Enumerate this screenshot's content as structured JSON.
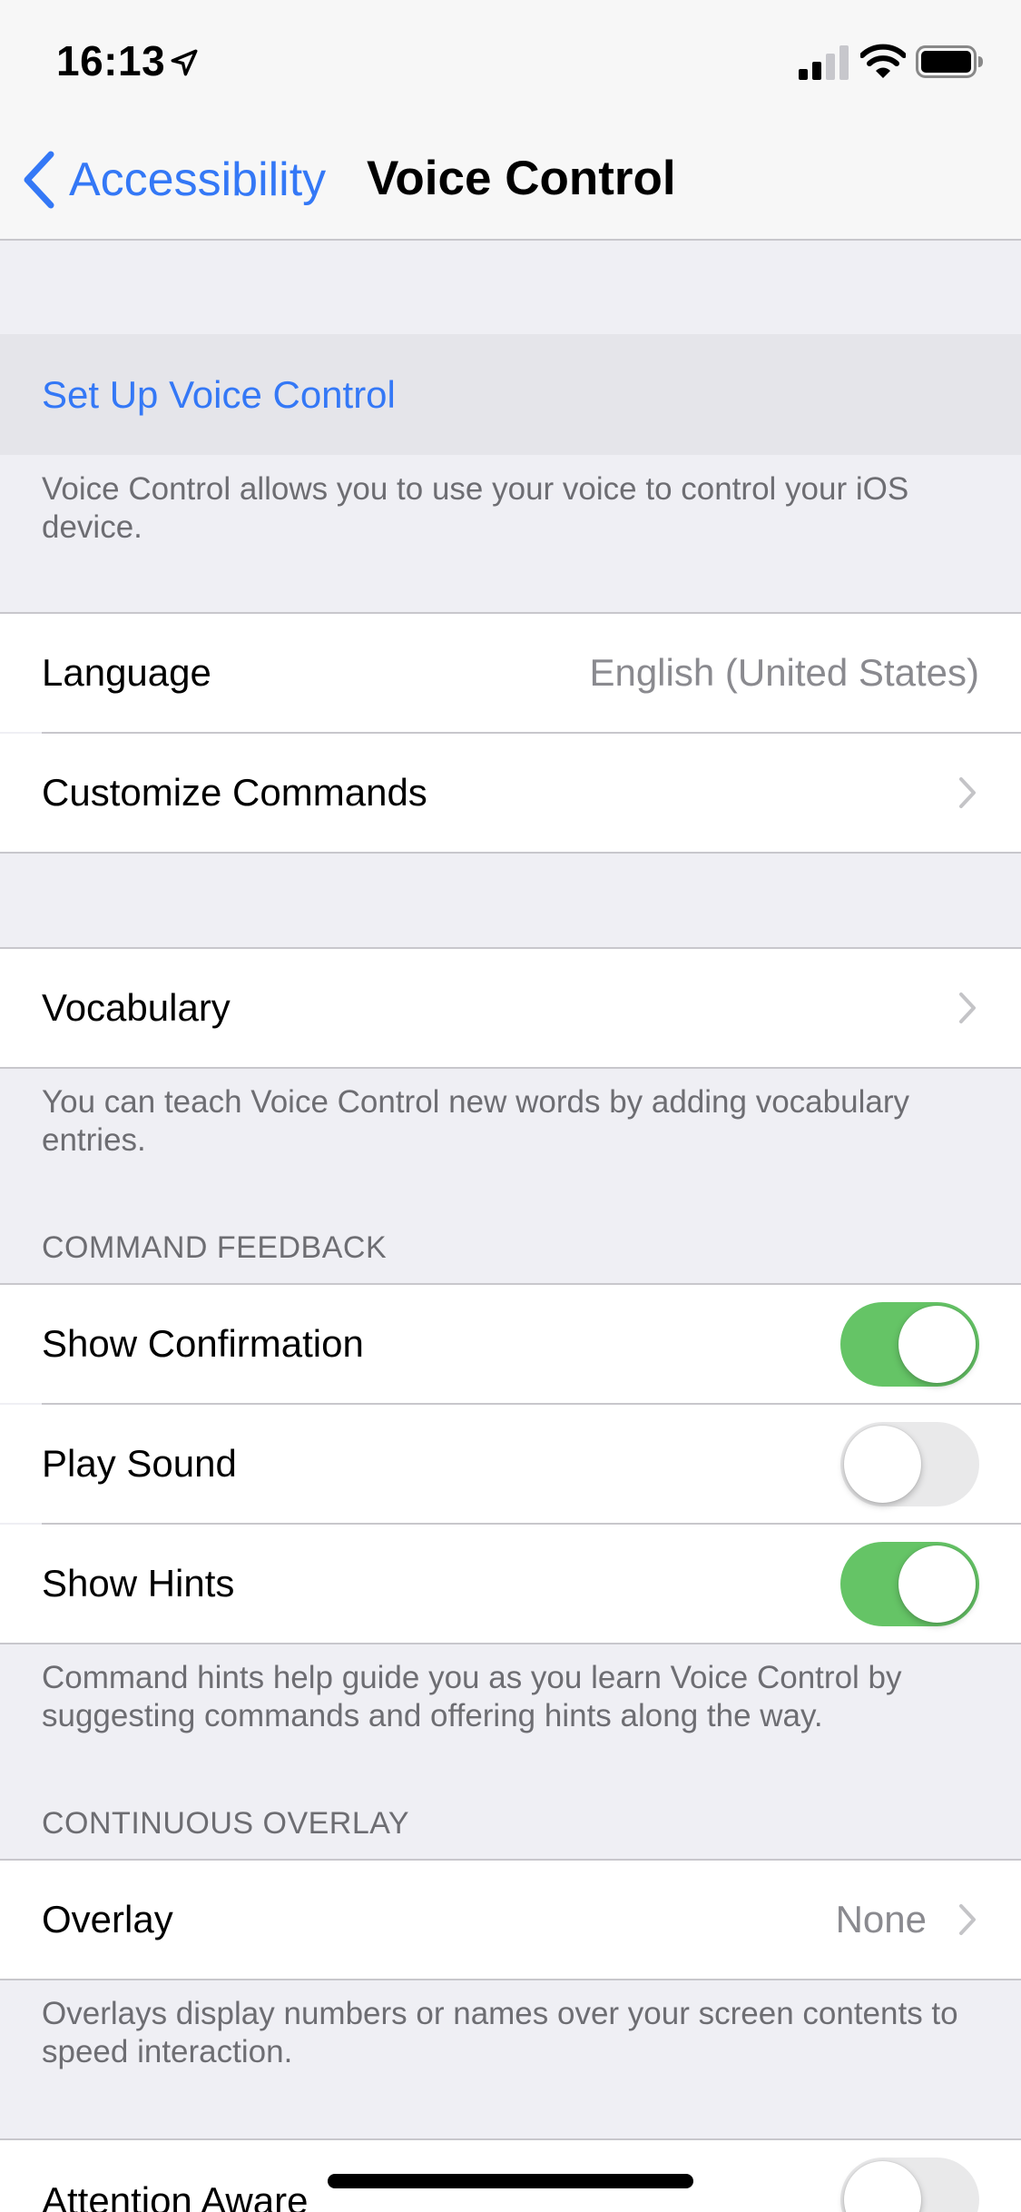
{
  "status_bar": {
    "time": "16:13",
    "icons": [
      "location-arrow-icon",
      "cellular-signal-icon",
      "wifi-icon",
      "battery-icon"
    ]
  },
  "nav": {
    "back_label": "Accessibility",
    "title": "Voice Control"
  },
  "colors": {
    "accent": "#3478f6",
    "toggle_on": "#65c466",
    "toggle_off": "#e9e9ea",
    "background": "#efeff4",
    "secondary_text": "#6d6d72"
  },
  "setup": {
    "label": "Set Up Voice Control",
    "footer": "Voice Control allows you to use your voice to control your iOS device."
  },
  "language_row": {
    "label": "Language",
    "value": "English (United States)"
  },
  "customize_row": {
    "label": "Customize Commands"
  },
  "vocabulary": {
    "label": "Vocabulary",
    "footer": "You can teach Voice Control new words by adding vocabulary entries."
  },
  "command_feedback": {
    "header": "COMMAND FEEDBACK",
    "items": [
      {
        "label": "Show Confirmation",
        "on": true
      },
      {
        "label": "Play Sound",
        "on": false
      },
      {
        "label": "Show Hints",
        "on": true
      }
    ],
    "footer": "Command hints help guide you as you learn Voice Control by suggesting commands and offering hints along the way."
  },
  "continuous_overlay": {
    "header": "CONTINUOUS OVERLAY",
    "label": "Overlay",
    "value": "None",
    "footer": "Overlays display numbers or names over your screen contents to speed interaction."
  },
  "attention_aware": {
    "label": "Attention Aware",
    "on": false
  }
}
